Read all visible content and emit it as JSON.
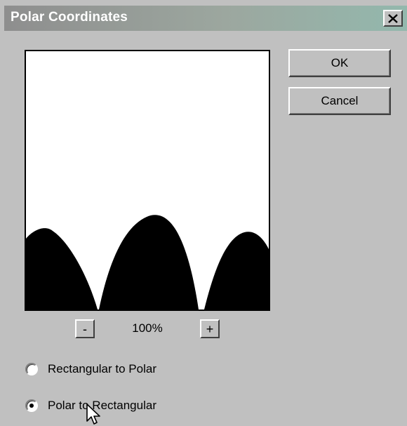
{
  "window": {
    "title": "Polar Coordinates",
    "close_glyph": "✕"
  },
  "buttons": {
    "ok_label": "OK",
    "cancel_label": "Cancel"
  },
  "zoom": {
    "out_label": "-",
    "level": "100%",
    "in_label": "+"
  },
  "options": [
    {
      "label": "Rectangular to Polar",
      "selected": false
    },
    {
      "label": "Polar to Rectangular",
      "selected": true
    }
  ],
  "colors": {
    "dialog_bg": "#c0c0c0",
    "title_text": "#ffffff",
    "preview_bg": "#ffffff",
    "preview_shape": "#000000"
  },
  "icons": {
    "close": "close-icon",
    "cursor": "mouse-pointer-icon"
  }
}
